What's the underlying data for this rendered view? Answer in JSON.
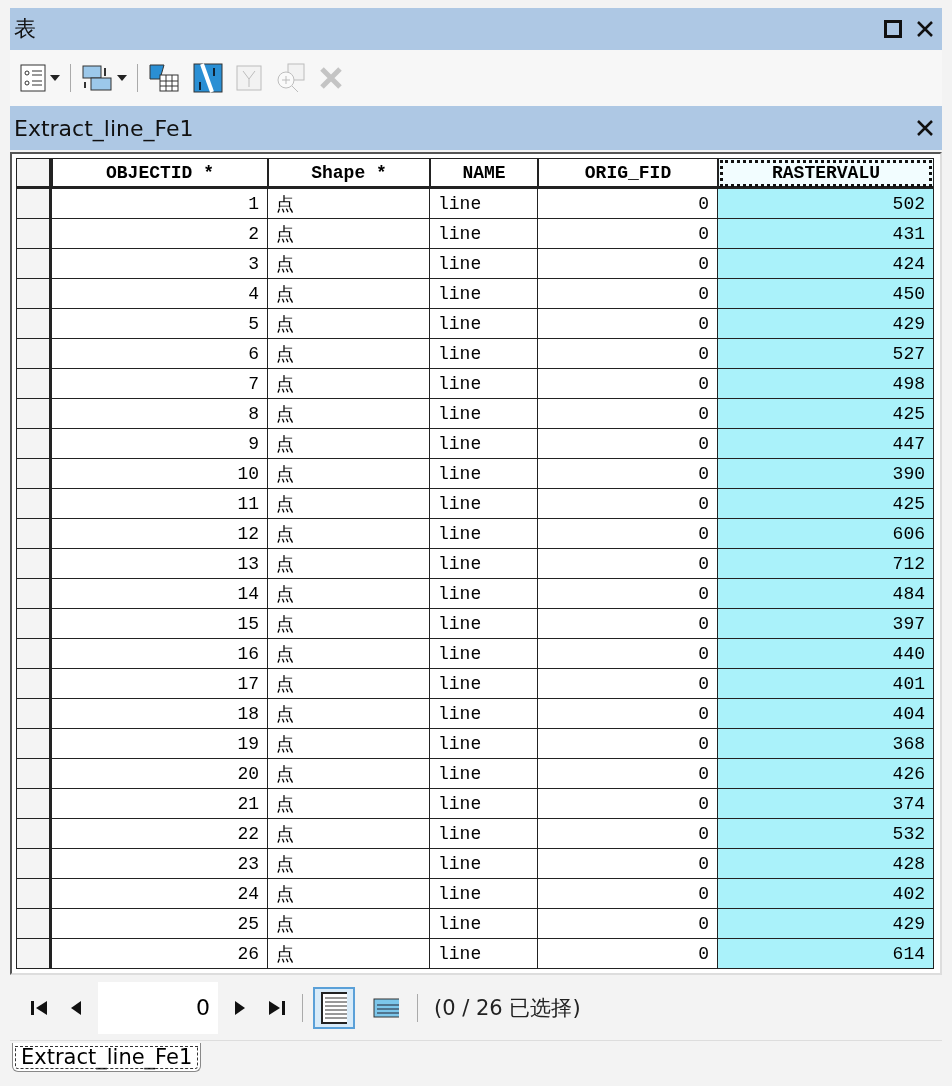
{
  "window": {
    "title": "表"
  },
  "toolbar": [
    {
      "kind": "dropdown",
      "disabled": false
    },
    {
      "kind": "dropdown",
      "disabled": false
    },
    {
      "kind": "button",
      "disabled": false
    },
    {
      "kind": "button",
      "disabled": false
    },
    {
      "kind": "button",
      "disabled": true
    },
    {
      "kind": "button",
      "disabled": true
    },
    {
      "kind": "button",
      "disabled": true
    }
  ],
  "table_title": "Extract_line_Fe1",
  "table": {
    "columns": [
      {
        "label": "OBJECTID *",
        "kind": "number",
        "selected": false
      },
      {
        "label": "Shape *",
        "kind": "text",
        "selected": false
      },
      {
        "label": "NAME",
        "kind": "text",
        "selected": false
      },
      {
        "label": "ORIG_FID",
        "kind": "number",
        "selected": false
      },
      {
        "label": "RASTERVALU",
        "kind": "number",
        "selected": true
      }
    ],
    "rows": [
      [
        "1",
        "点",
        "line",
        "0",
        "502"
      ],
      [
        "2",
        "点",
        "line",
        "0",
        "431"
      ],
      [
        "3",
        "点",
        "line",
        "0",
        "424"
      ],
      [
        "4",
        "点",
        "line",
        "0",
        "450"
      ],
      [
        "5",
        "点",
        "line",
        "0",
        "429"
      ],
      [
        "6",
        "点",
        "line",
        "0",
        "527"
      ],
      [
        "7",
        "点",
        "line",
        "0",
        "498"
      ],
      [
        "8",
        "点",
        "line",
        "0",
        "425"
      ],
      [
        "9",
        "点",
        "line",
        "0",
        "447"
      ],
      [
        "10",
        "点",
        "line",
        "0",
        "390"
      ],
      [
        "11",
        "点",
        "line",
        "0",
        "425"
      ],
      [
        "12",
        "点",
        "line",
        "0",
        "606"
      ],
      [
        "13",
        "点",
        "line",
        "0",
        "712"
      ],
      [
        "14",
        "点",
        "line",
        "0",
        "484"
      ],
      [
        "15",
        "点",
        "line",
        "0",
        "397"
      ],
      [
        "16",
        "点",
        "line",
        "0",
        "440"
      ],
      [
        "17",
        "点",
        "line",
        "0",
        "401"
      ],
      [
        "18",
        "点",
        "line",
        "0",
        "404"
      ],
      [
        "19",
        "点",
        "line",
        "0",
        "368"
      ],
      [
        "20",
        "点",
        "line",
        "0",
        "426"
      ],
      [
        "21",
        "点",
        "line",
        "0",
        "374"
      ],
      [
        "22",
        "点",
        "line",
        "0",
        "532"
      ],
      [
        "23",
        "点",
        "line",
        "0",
        "428"
      ],
      [
        "24",
        "点",
        "line",
        "0",
        "402"
      ],
      [
        "25",
        "点",
        "line",
        "0",
        "429"
      ],
      [
        "26",
        "点",
        "line",
        "0",
        "614"
      ]
    ]
  },
  "navigator": {
    "record": "0",
    "views": [
      {
        "selected": true
      },
      {
        "selected": false
      }
    ],
    "status": "(0 / 26 已选择)"
  },
  "tabs": [
    {
      "label": "Extract_line_Fe1",
      "selected": true
    }
  ]
}
